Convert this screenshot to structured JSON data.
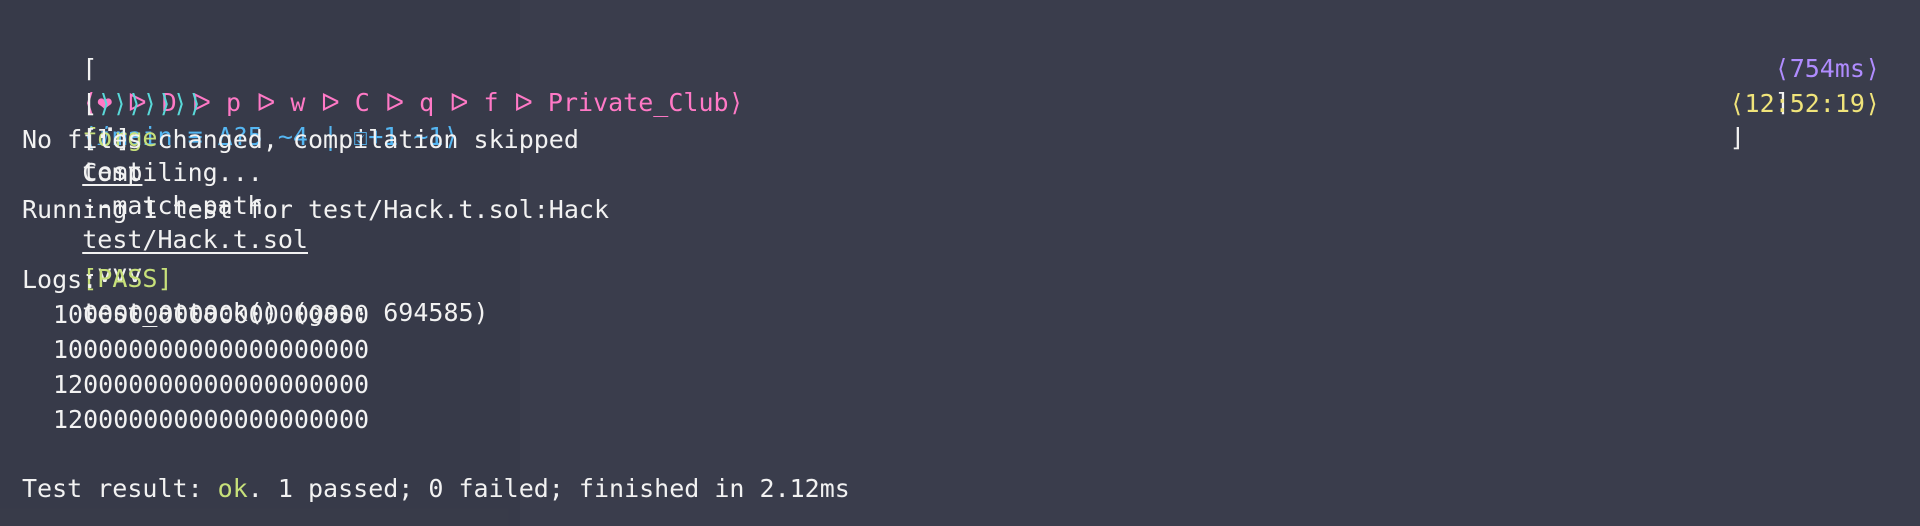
{
  "prompt": {
    "open_bracket": "⌈",
    "segments": [
      {
        "text": "⟨❤ ᐅ D ᐅ p ᐅ w ᐅ C ᐅ q ᐅ f ᐅ Private_Club⟩",
        "color": "#ff79c6"
      },
      {
        "text": "⟨ⅈmain ≡ Δ?5 ~4 | ",
        "color": "#55b6f2"
      },
      {
        "text": "☑",
        "color": "#55b6f2"
      },
      {
        "text": "+1 ~1⟩",
        "color": "#55b6f2"
      }
    ],
    "duration": "⟨754ms⟩",
    "close_bracket": "⌉",
    "second_open": "⌊",
    "arrows": "⟩⟩⟩⟩⟩⟩⟩",
    "command_name": "forge",
    "command_sub": "test",
    "command_flag": "--match-path",
    "command_path": "test/Hack.t.sol",
    "command_verbose": "-vvv",
    "time": "⟨12:52:19⟩",
    "second_close": "⌋"
  },
  "output": {
    "compiling_spinner": "[⠊]",
    "compiling": "Compiling...",
    "no_changes": "No files changed, compilation skipped",
    "running": "Running 1 test for test/Hack.t.sol:Hack",
    "pass_tag": "[PASS]",
    "pass_rest": "test_attack() (gas: 694585)",
    "logs_label": "Logs:",
    "logs": [
      "100000000000000000000",
      "100000000000000000000",
      "120000000000000000000",
      "120000000000000000000"
    ],
    "result_prefix": "Test result: ",
    "result_ok": "ok",
    "result_rest": ". 1 passed; 0 failed; finished in 2.12ms"
  },
  "colors": {
    "background": "#3a3d4c",
    "pink": "#ff79c6",
    "blue": "#55b6f2",
    "cyan": "#59d9d9",
    "yellow": "#f0e47a",
    "green": "#c7e07a",
    "purple": "#b08cff"
  }
}
